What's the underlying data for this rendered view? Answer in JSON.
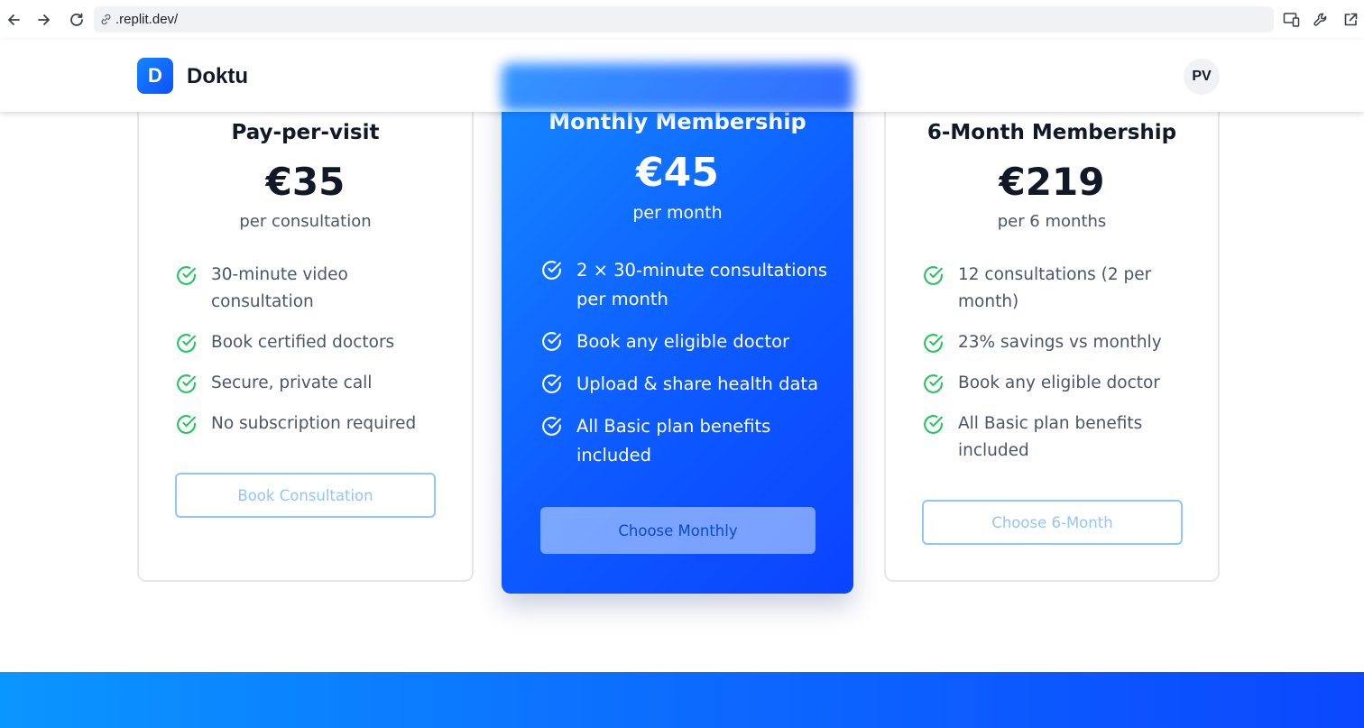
{
  "browser": {
    "url": ".replit.dev/"
  },
  "header": {
    "logo_letter": "D",
    "brand": "Doktu",
    "avatar_initials": "PV"
  },
  "plans": [
    {
      "title": "Pay-per-visit",
      "price": "€35",
      "period": "per consultation",
      "features": [
        "30-minute video consultation",
        "Book certified doctors",
        "Secure, private call",
        "No subscription required"
      ],
      "button": "Book Consultation"
    },
    {
      "title": "Monthly Membership",
      "price": "€45",
      "period": "per month",
      "features": [
        "2 × 30-minute consultations per month",
        "Book any eligible doctor",
        "Upload & share health data",
        "All Basic plan benefits included"
      ],
      "button": "Choose Monthly"
    },
    {
      "title": "6-Month Membership",
      "price": "€219",
      "period": "per 6 months",
      "features": [
        "12 consultations (2 per month)",
        "23% savings vs monthly",
        "Book any eligible doctor",
        "All Basic plan benefits included"
      ],
      "button": "Choose 6-Month"
    }
  ],
  "colors": {
    "brand_blue": "#0d5bff",
    "check_green": "#22c55e",
    "outline_button": "#93c5f5"
  }
}
